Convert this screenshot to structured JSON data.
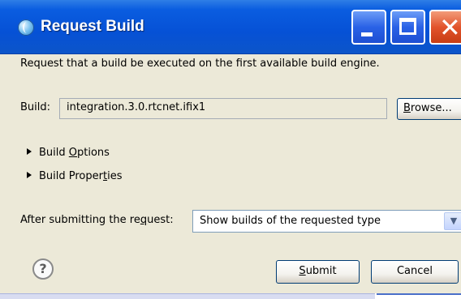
{
  "window": {
    "title": "Request Build",
    "icon": "globe-icon",
    "controls": [
      "minimize-icon",
      "maximize-icon",
      "close-icon"
    ]
  },
  "description": "Request that a build be executed on the first available build engine.",
  "build": {
    "label": "Build:",
    "value": "integration.3.0.rtcnet.ifix1",
    "browse_pre": "",
    "browse_u": "B",
    "browse_post": "rowse..."
  },
  "sections": {
    "options_pre": "Build ",
    "options_u": "O",
    "options_post": "ptions",
    "properties_pre": "Build Proper",
    "properties_u": "t",
    "properties_post": "ies"
  },
  "after_submit": {
    "label_pre": "After submitting the re",
    "label_u": "q",
    "label_post": "uest:",
    "selected": "Show builds of the requested type"
  },
  "buttons": {
    "submit_u": "S",
    "submit_post": "ubmit",
    "cancel": "Cancel"
  },
  "icons": {
    "help": "help-icon",
    "expand": "triangle-right-icon",
    "dropdown": "chevron-down-icon"
  }
}
